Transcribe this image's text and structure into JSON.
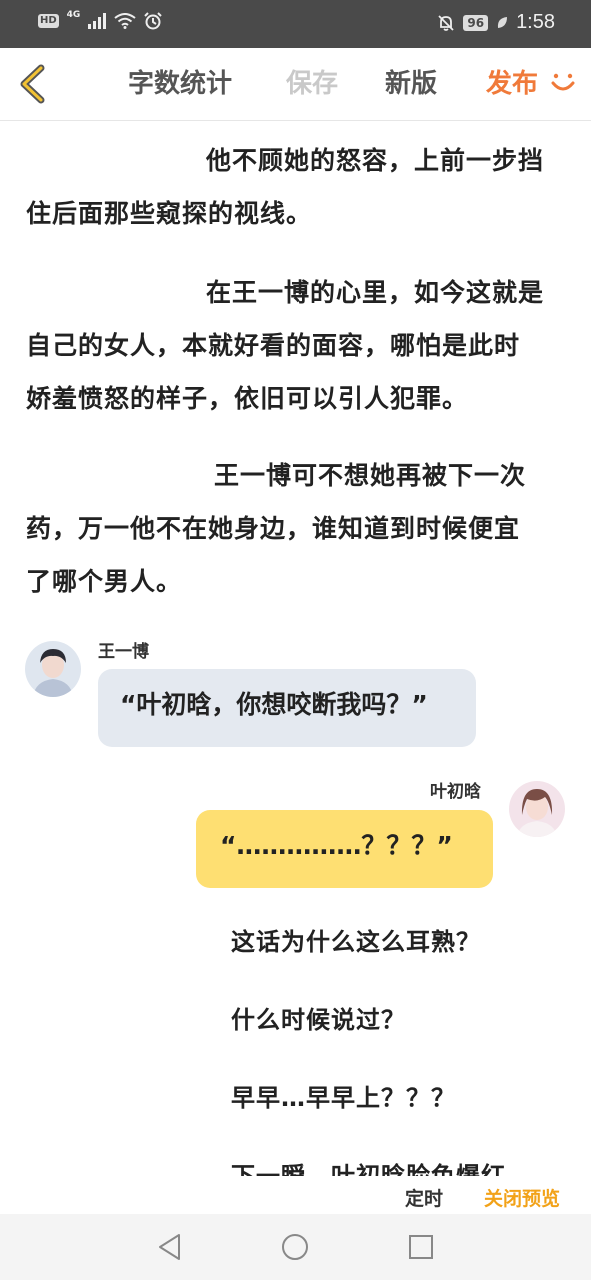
{
  "status_bar": {
    "hd": "HD",
    "network": "4G",
    "battery": "96",
    "time": "1:58"
  },
  "toolbar": {
    "word_count": "字数统计",
    "save": "保存",
    "new_version": "新版",
    "publish": "发布"
  },
  "story": {
    "paragraphs": [
      {
        "line1": "他不顾她的怒容，上前一步挡",
        "line2": "住后面那些窥探的视线。"
      },
      {
        "line1": "在王一博的心里，如今这就是",
        "line2": "自己的女人，本就好看的面容，哪怕是此时",
        "line3": "娇羞愤怒的样子，依旧可以引人犯罪。"
      },
      {
        "line1": "王一博可不想她再被下一次",
        "line2": "药，万一他不在她身边，谁知道到时候便宜",
        "line3": "了哪个男人。"
      }
    ],
    "dialogue_left": {
      "speaker": "王一博",
      "text": "“叶初晗，你想咬断我吗？”"
    },
    "dialogue_right": {
      "speaker": "叶初晗",
      "text": "“……………？？？”"
    },
    "short_lines": [
      "这话为什么这么耳熟？",
      "什么时候说过？",
      "早早…早早上？？？",
      "下一瞬，叶初晗脸色爆红"
    ]
  },
  "actions": {
    "timer": "定时",
    "close_preview": "关闭预览"
  },
  "colors": {
    "accent_publish": "#f07a3a",
    "accent_close": "#f2a218",
    "bubble_left": "#e4e9f0",
    "bubble_right": "#fedf72"
  }
}
